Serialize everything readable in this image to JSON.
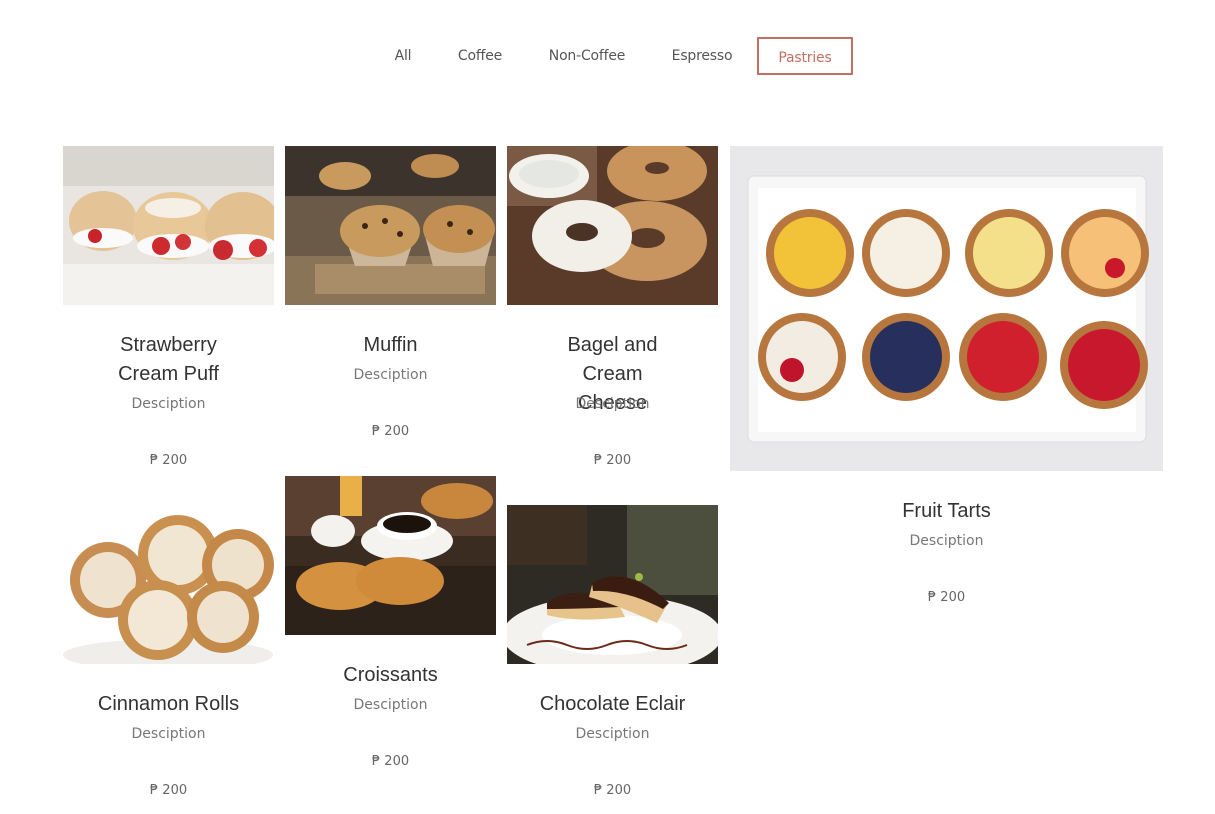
{
  "filters": {
    "all": "All",
    "coffee": "Coffee",
    "non_coffee": "Non-Coffee",
    "espresso": "Espresso",
    "pastries": "Pastries",
    "active": "Pastries",
    "accent_color": "#c0705f"
  },
  "products": [
    {
      "title": "Strawberry Cream Puff",
      "desc": "Desciption",
      "price": "₱ 200"
    },
    {
      "title": "Muffin",
      "desc": "Desciption",
      "price": "₱ 200"
    },
    {
      "title": "Bagel and Cream Cheese",
      "desc": "Desciption",
      "price": "₱ 200"
    },
    {
      "title": "Fruit Tarts",
      "desc": "Desciption",
      "price": "₱ 200"
    },
    {
      "title": "Cinnamon Rolls",
      "desc": "Desciption",
      "price": "₱ 200"
    },
    {
      "title": "Croissants",
      "desc": "Desciption",
      "price": "₱ 200"
    },
    {
      "title": "Chocolate Eclair",
      "desc": "Desciption",
      "price": "₱ 200"
    }
  ]
}
